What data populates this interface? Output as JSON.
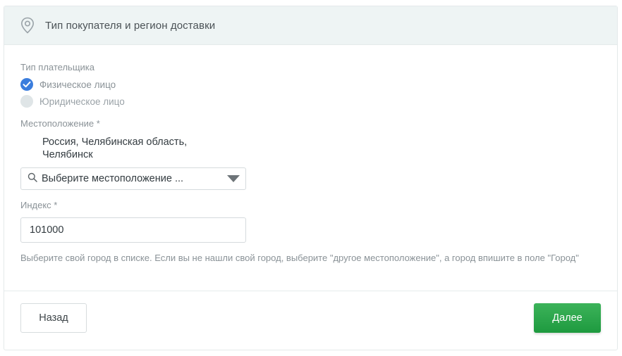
{
  "header": {
    "icon": "map-pin-icon",
    "title": "Тип покупателя и регион доставки"
  },
  "payer_type": {
    "label": "Тип плательщика",
    "options": [
      {
        "label": "Физическое лицо",
        "checked": true
      },
      {
        "label": "Юридическое лицо",
        "checked": false
      }
    ]
  },
  "location": {
    "label": "Местоположение *",
    "selected_line1": "Россия, Челябинская область,",
    "selected_line2": "Челябинск",
    "search_icon": "search-icon",
    "select_placeholder": "Выберите местоположение ...",
    "caret_icon": "triangle-down-icon"
  },
  "index": {
    "label": "Индекс *",
    "value": "101000"
  },
  "hint": "Выберите свой город в списке. Если вы не нашли свой город, выберите \"другое местоположение\", а город впишите в поле \"Город\"",
  "buttons": {
    "back": "Назад",
    "next": "Далее"
  },
  "colors": {
    "accent_blue": "#3b7ddd",
    "next_green": "#1e9a3f",
    "header_bg": "#eef4f4"
  }
}
